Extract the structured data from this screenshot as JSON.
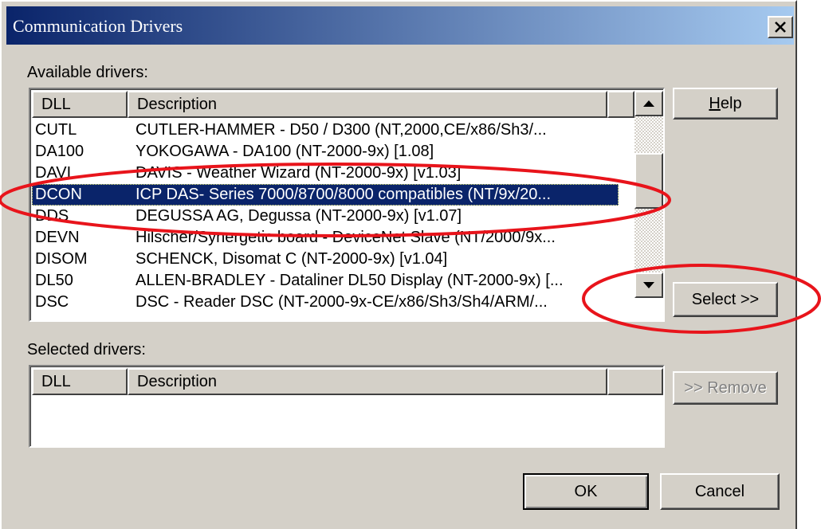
{
  "window": {
    "title": "Communication Drivers"
  },
  "available": {
    "label": "Available drivers:",
    "columns": [
      "DLL",
      "Description"
    ],
    "rows": [
      {
        "dll": "CUTL",
        "desc": "CUTLER-HAMMER - D50 / D300 (NT,2000,CE/x86/Sh3/..."
      },
      {
        "dll": "DA100",
        "desc": "YOKOGAWA - DA100 (NT-2000-9x) [1.08]"
      },
      {
        "dll": "DAVI",
        "desc": "DAVIS - Weather Wizard (NT-2000-9x) [v1.03]"
      },
      {
        "dll": "DCON",
        "desc": "ICP DAS- Series 7000/8700/8000 compatibles (NT/9x/20...",
        "selected": true
      },
      {
        "dll": "DDS",
        "desc": "DEGUSSA AG, Degussa (NT-2000-9x) [v1.07]"
      },
      {
        "dll": "DEVN",
        "desc": "Hilscher/Synergetic board - DeviceNet Slave (NT/2000/9x..."
      },
      {
        "dll": "DISOM",
        "desc": "SCHENCK, Disomat C (NT-2000-9x) [v1.04]"
      },
      {
        "dll": "DL50",
        "desc": "ALLEN-BRADLEY - Dataliner DL50 Display (NT-2000-9x) [..."
      },
      {
        "dll": "DSC",
        "desc": "DSC  - Reader DSC (NT-2000-9x-CE/x86/Sh3/Sh4/ARM/..."
      }
    ]
  },
  "selected": {
    "label": "Selected drivers:",
    "columns": [
      "DLL",
      "Description"
    ]
  },
  "buttons": {
    "help": "Help",
    "help_mnemonic": "H",
    "help_rest": "elp",
    "select": "Select >>",
    "remove": ">> Remove",
    "ok": "OK",
    "cancel": "Cancel"
  },
  "colors": {
    "face": "#d4d0c8",
    "selection": "#0a246a",
    "annotation": "#e8141b"
  },
  "icons": [
    "close-icon",
    "scroll-up-arrow-icon",
    "scroll-down-arrow-icon"
  ]
}
